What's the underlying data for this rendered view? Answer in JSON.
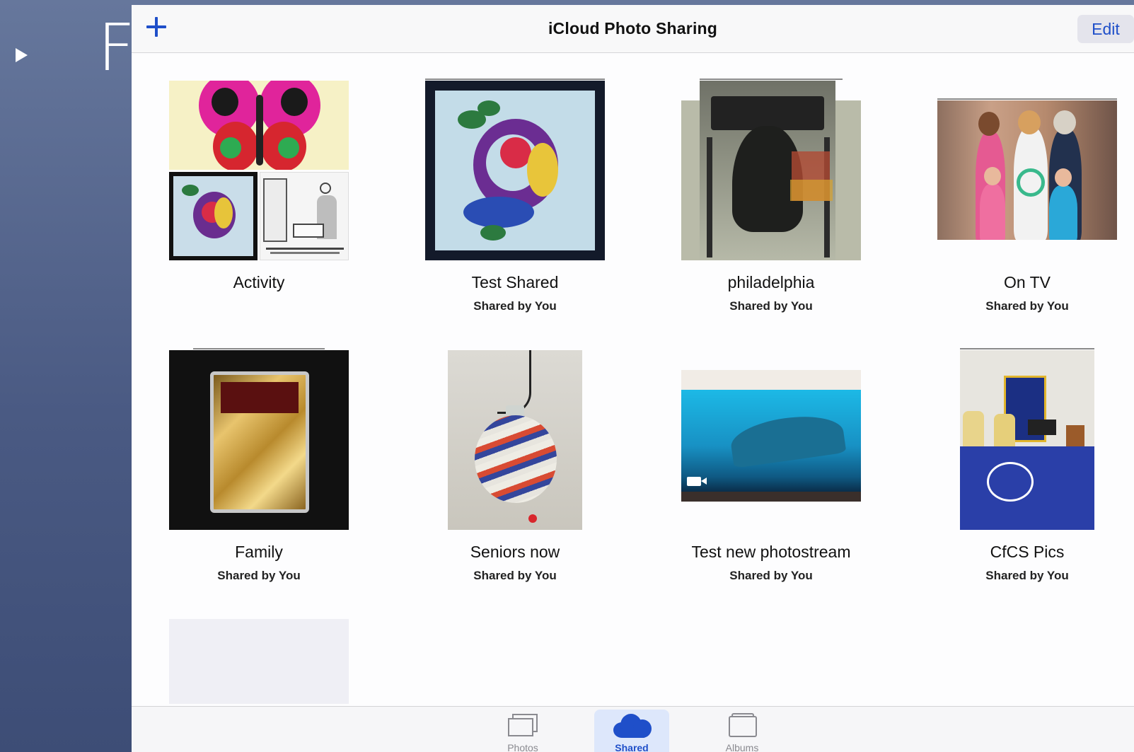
{
  "navbar": {
    "title": "iCloud Photo Sharing",
    "edit_label": "Edit",
    "add_icon": "plus-icon"
  },
  "albums": [
    {
      "title": "Activity",
      "subtitle": ""
    },
    {
      "title": "Test Shared",
      "subtitle": "Shared by You"
    },
    {
      "title": "philadelphia",
      "subtitle": "Shared by You"
    },
    {
      "title": "On TV",
      "subtitle": "Shared by You"
    },
    {
      "title": "Family",
      "subtitle": "Shared by You"
    },
    {
      "title": "Seniors now",
      "subtitle": "Shared by You"
    },
    {
      "title": "Test new photostream",
      "subtitle": "Shared by You"
    },
    {
      "title": "CfCS Pics",
      "subtitle": "Shared by You"
    }
  ],
  "tabbar": {
    "tabs": [
      {
        "label": "Photos",
        "icon": "photos-icon",
        "active": false
      },
      {
        "label": "Shared",
        "icon": "cloud-icon",
        "active": true
      },
      {
        "label": "Albums",
        "icon": "albums-icon",
        "active": false
      }
    ]
  },
  "colors": {
    "accent": "#1f4fc9",
    "active_tab_bg": "#dde7fb",
    "backdrop": "#4a5a83"
  }
}
